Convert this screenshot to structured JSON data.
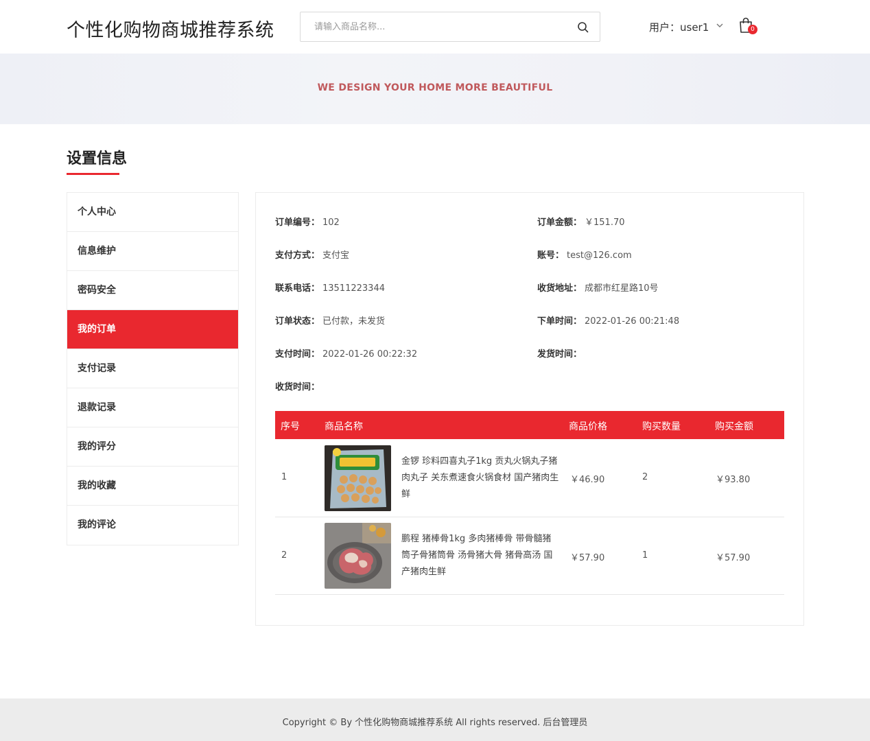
{
  "header": {
    "site_title": "个性化购物商城推荐系统",
    "search_placeholder": "请输入商品名称...",
    "user_label": "用户：user1",
    "cart_count": "0"
  },
  "banner": {
    "text": "WE DESIGN YOUR HOME MORE BEAUTIFUL"
  },
  "section_title": "设置信息",
  "sidebar": {
    "items": [
      {
        "label": "个人中心"
      },
      {
        "label": "信息维护"
      },
      {
        "label": "密码安全"
      },
      {
        "label": "我的订单",
        "active": true
      },
      {
        "label": "支付记录"
      },
      {
        "label": "退款记录"
      },
      {
        "label": "我的评分"
      },
      {
        "label": "我的收藏"
      },
      {
        "label": "我的评论"
      }
    ]
  },
  "order": {
    "order_no_label": "订单编号：",
    "order_no": "102",
    "amount_label": "订单金额：",
    "amount": "￥151.70",
    "pay_method_label": "支付方式：",
    "pay_method": "支付宝",
    "account_label": "账号：",
    "account": "test@126.com",
    "phone_label": "联系电话：",
    "phone": "13511223344",
    "address_label": "收货地址：",
    "address": "成都市红星路10号",
    "status_label": "订单状态：",
    "status": "已付款，未发货",
    "order_time_label": "下单时间：",
    "order_time": "2022-01-26 00:21:48",
    "pay_time_label": "支付时间：",
    "pay_time": "2022-01-26 00:22:32",
    "ship_time_label": "发货时间：",
    "ship_time": "",
    "receive_time_label": "收货时间：",
    "receive_time": ""
  },
  "table": {
    "headers": [
      "序号",
      "商品名称",
      "商品价格",
      "购买数量",
      "购买金额"
    ],
    "rows": [
      {
        "index": "1",
        "name": "金锣 珍料四喜丸子1kg 贡丸火锅丸子猪肉丸子 关东煮速食火锅食材 国产猪肉生鲜",
        "price": "￥46.90",
        "qty": "2",
        "total": "￥93.80"
      },
      {
        "index": "2",
        "name": "鹏程 猪棒骨1kg 多肉猪棒骨 带骨髓猪筒子骨猪筒骨 汤骨猪大骨 猪骨高汤 国产猪肉生鲜",
        "price": "￥57.90",
        "qty": "1",
        "total": "￥57.90"
      }
    ]
  },
  "footer": {
    "text": "Copyright © By 个性化购物商城推荐系统 All rights reserved. 后台管理员"
  },
  "colors": {
    "accent": "#e9282f",
    "banner_text": "#c0595c"
  }
}
